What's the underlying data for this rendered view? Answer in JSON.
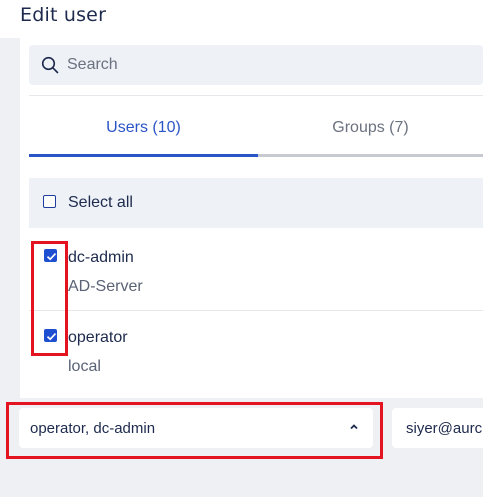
{
  "dialog": {
    "title": "Edit user"
  },
  "search": {
    "placeholder": "Search",
    "icon": "search-icon"
  },
  "tabs": [
    {
      "label": "Users (10)",
      "active": true
    },
    {
      "label": "Groups (7)",
      "active": false
    }
  ],
  "select_all": {
    "label": "Select all",
    "checked": false
  },
  "users": [
    {
      "name": "dc-admin",
      "source": "AD-Server",
      "checked": true
    },
    {
      "name": "operator",
      "source": "local",
      "checked": true
    }
  ],
  "selection": {
    "value": "operator, dc-admin",
    "icon": "chevron-up-icon"
  },
  "email": {
    "value": "siyer@aurc"
  },
  "colors": {
    "accent": "#2a55c6",
    "checkbox": "#1f4fd1",
    "highlight": "#e3141f"
  }
}
